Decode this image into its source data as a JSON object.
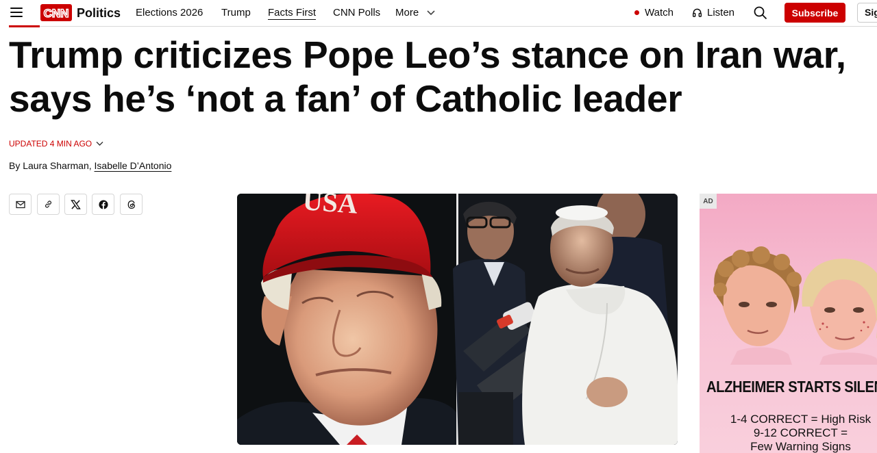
{
  "header": {
    "logo_text": "CNN",
    "section": "Politics",
    "nav": [
      {
        "label": "Elections 2026",
        "active": false
      },
      {
        "label": "Trump",
        "active": false
      },
      {
        "label": "Facts First",
        "active": true
      },
      {
        "label": "CNN Polls",
        "active": false
      },
      {
        "label": "More",
        "active": false
      }
    ],
    "watch_label": "Watch",
    "listen_label": "Listen",
    "subscribe_label": "Subscribe",
    "signin_label": "Sig",
    "icons": [
      "hamburger-menu-icon",
      "chevron-down-icon",
      "live-dot-icon",
      "headphones-icon",
      "search-icon"
    ]
  },
  "article": {
    "headline_line1": "Trump criticizes Pope Leo’s stance on Iran war,",
    "headline_line2": "says he’s ‘not a fan’ of Catholic leader",
    "updated": "UPDATED 4 MIN AGO",
    "byline_prefix": "By",
    "author1": "Laura Sharman",
    "separator": ",",
    "author2": "Isabelle D’Antonio"
  },
  "share": {
    "buttons": [
      "email-icon",
      "link-icon",
      "x-icon",
      "facebook-icon",
      "threads-icon"
    ]
  },
  "hero": {
    "cap_text": "USA"
  },
  "ad": {
    "badge": "AD",
    "headline": "ALZHEIMER STARTS SILENT",
    "line1": "1-4 CORRECT = High Risk",
    "line2": "9-12 CORRECT =",
    "line3": "Few Warning Signs"
  },
  "colors": {
    "brand_red": "#cc0000",
    "text": "#0c0c0c",
    "ad_pink": "#f5b3cb"
  }
}
